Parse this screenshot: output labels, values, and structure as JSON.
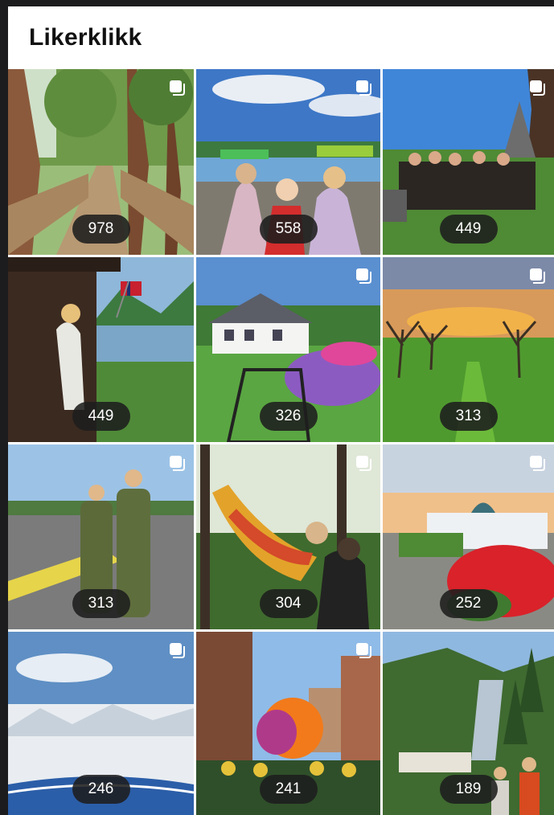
{
  "header": {
    "title": "Likerklikk"
  },
  "tiles": [
    {
      "likes": "978",
      "icon": "multiple-photos-icon"
    },
    {
      "likes": "558",
      "icon": "multiple-photos-icon"
    },
    {
      "likes": "449",
      "icon": "multiple-photos-icon"
    },
    {
      "likes": "449",
      "icon": "none"
    },
    {
      "likes": "326",
      "icon": "multiple-photos-icon"
    },
    {
      "likes": "313",
      "icon": "multiple-photos-icon"
    },
    {
      "likes": "313",
      "icon": "multiple-photos-icon"
    },
    {
      "likes": "304",
      "icon": "multiple-photos-icon"
    },
    {
      "likes": "252",
      "icon": "multiple-photos-icon"
    },
    {
      "likes": "246",
      "icon": "multiple-photos-icon"
    },
    {
      "likes": "241",
      "icon": "multiple-photos-icon"
    },
    {
      "likes": "189",
      "icon": "none"
    }
  ],
  "colors": {
    "badge_bg": "#1e1e1e",
    "background": "#ffffff",
    "frame": "#1c1c1e"
  }
}
